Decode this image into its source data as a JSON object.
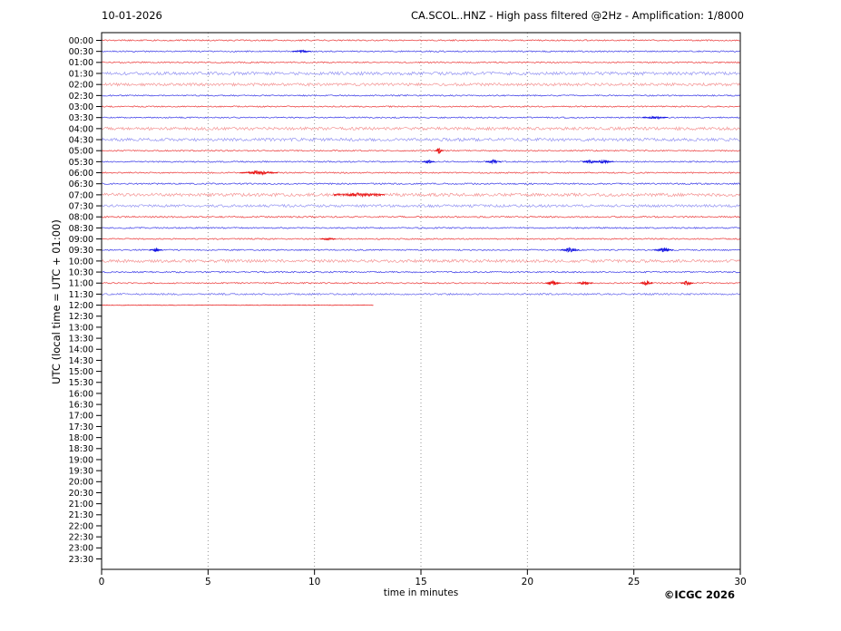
{
  "header": {
    "date": "10-01-2026",
    "title": "CA.SCOL..HNZ - High pass filtered @2Hz - Amplification: 1/8000"
  },
  "footer": {
    "copyright": "©ICGC 2026"
  },
  "chart_data": {
    "type": "line",
    "subtype": "helicorder-seismogram",
    "title": "CA.SCOL..HNZ - High pass filtered @2Hz - Amplification: 1/8000",
    "date_label": "10-01-2026",
    "xlabel": "time in minutes",
    "ylabel": "UTC (local time = UTC + 01:00)",
    "xlim": [
      0,
      30
    ],
    "x_ticks": [
      0,
      5,
      10,
      15,
      20,
      25,
      30
    ],
    "grid_minutes": [
      5,
      10,
      15,
      20,
      25
    ],
    "grid_style": "dotted",
    "legend": "none",
    "colors": {
      "red": "#e60000",
      "blue": "#0000e0",
      "grid": "#8a8a8a",
      "frame": "#000000"
    },
    "trace_color_rule": "hh:00 rows red, hh:30 rows blue; recording stops at 12:00 + 12.8 min",
    "rows": [
      {
        "label": "00:00",
        "color": "red",
        "noise": 0.7,
        "end_minute": 30,
        "events": []
      },
      {
        "label": "00:30",
        "color": "blue",
        "noise": 0.7,
        "end_minute": 30,
        "events": [
          {
            "m": 9.4,
            "a": 0.9,
            "w": 0.15
          }
        ]
      },
      {
        "label": "01:00",
        "color": "red",
        "noise": 0.7,
        "end_minute": 30,
        "events": []
      },
      {
        "label": "01:30",
        "color": "blue",
        "noise": 1.7,
        "end_minute": 30,
        "events": []
      },
      {
        "label": "02:00",
        "color": "red",
        "noise": 1.5,
        "end_minute": 30,
        "events": []
      },
      {
        "label": "02:30",
        "color": "blue",
        "noise": 0.7,
        "end_minute": 30,
        "events": []
      },
      {
        "label": "03:00",
        "color": "red",
        "noise": 0.7,
        "end_minute": 30,
        "events": []
      },
      {
        "label": "03:30",
        "color": "blue",
        "noise": 0.7,
        "end_minute": 30,
        "events": [
          {
            "m": 26.0,
            "a": 0.9,
            "w": 0.2
          }
        ]
      },
      {
        "label": "04:00",
        "color": "red",
        "noise": 1.6,
        "end_minute": 30,
        "events": []
      },
      {
        "label": "04:30",
        "color": "blue",
        "noise": 1.6,
        "end_minute": 30,
        "events": []
      },
      {
        "label": "05:00",
        "color": "red",
        "noise": 0.7,
        "end_minute": 30,
        "events": [
          {
            "m": 15.85,
            "a": 3.3,
            "w": 0.07
          }
        ]
      },
      {
        "label": "05:30",
        "color": "blue",
        "noise": 0.7,
        "end_minute": 30,
        "events": [
          {
            "m": 15.35,
            "a": 1.6,
            "w": 0.1
          },
          {
            "m": 18.4,
            "a": 1.5,
            "w": 0.12
          },
          {
            "m": 22.95,
            "a": 1.5,
            "w": 0.12
          },
          {
            "m": 23.6,
            "a": 1.6,
            "w": 0.15
          }
        ]
      },
      {
        "label": "06:00",
        "color": "red",
        "noise": 0.7,
        "end_minute": 30,
        "events": [
          {
            "m": 7.4,
            "a": 1.8,
            "w": 0.3
          }
        ]
      },
      {
        "label": "06:30",
        "color": "blue",
        "noise": 0.8,
        "end_minute": 30,
        "events": []
      },
      {
        "label": "07:00",
        "color": "red",
        "noise": 1.7,
        "end_minute": 30,
        "events": [
          {
            "m": 12.1,
            "a": 1.2,
            "w": 0.4
          }
        ]
      },
      {
        "label": "07:30",
        "color": "blue",
        "noise": 1.4,
        "end_minute": 30,
        "events": []
      },
      {
        "label": "08:00",
        "color": "red",
        "noise": 0.8,
        "end_minute": 30,
        "events": []
      },
      {
        "label": "08:30",
        "color": "blue",
        "noise": 0.7,
        "end_minute": 30,
        "events": []
      },
      {
        "label": "09:00",
        "color": "red",
        "noise": 0.7,
        "end_minute": 30,
        "events": [
          {
            "m": 10.65,
            "a": 0.9,
            "w": 0.12
          }
        ]
      },
      {
        "label": "09:30",
        "color": "blue",
        "noise": 0.7,
        "end_minute": 30,
        "events": [
          {
            "m": 2.55,
            "a": 1.4,
            "w": 0.1
          },
          {
            "m": 22.0,
            "a": 2.0,
            "w": 0.15
          },
          {
            "m": 26.4,
            "a": 2.0,
            "w": 0.15
          }
        ]
      },
      {
        "label": "10:00",
        "color": "red",
        "noise": 1.6,
        "end_minute": 30,
        "events": []
      },
      {
        "label": "10:30",
        "color": "blue",
        "noise": 0.8,
        "end_minute": 30,
        "events": []
      },
      {
        "label": "11:00",
        "color": "red",
        "noise": 0.7,
        "end_minute": 30,
        "events": [
          {
            "m": 21.2,
            "a": 1.9,
            "w": 0.12
          },
          {
            "m": 22.7,
            "a": 2.2,
            "w": 0.12
          },
          {
            "m": 25.6,
            "a": 1.9,
            "w": 0.1
          },
          {
            "m": 27.5,
            "a": 2.2,
            "w": 0.1
          }
        ]
      },
      {
        "label": "11:30",
        "color": "blue",
        "noise": 0.9,
        "end_minute": 30,
        "events": []
      },
      {
        "label": "12:00",
        "color": "red",
        "noise": 0.3,
        "end_minute": 12.8,
        "events": []
      },
      {
        "label": "12:30",
        "color": null,
        "noise": 0,
        "end_minute": 0,
        "events": []
      },
      {
        "label": "13:00",
        "color": null,
        "noise": 0,
        "end_minute": 0,
        "events": []
      },
      {
        "label": "13:30",
        "color": null,
        "noise": 0,
        "end_minute": 0,
        "events": []
      },
      {
        "label": "14:00",
        "color": null,
        "noise": 0,
        "end_minute": 0,
        "events": []
      },
      {
        "label": "14:30",
        "color": null,
        "noise": 0,
        "end_minute": 0,
        "events": []
      },
      {
        "label": "15:00",
        "color": null,
        "noise": 0,
        "end_minute": 0,
        "events": []
      },
      {
        "label": "15:30",
        "color": null,
        "noise": 0,
        "end_minute": 0,
        "events": []
      },
      {
        "label": "16:00",
        "color": null,
        "noise": 0,
        "end_minute": 0,
        "events": []
      },
      {
        "label": "16:30",
        "color": null,
        "noise": 0,
        "end_minute": 0,
        "events": []
      },
      {
        "label": "17:00",
        "color": null,
        "noise": 0,
        "end_minute": 0,
        "events": []
      },
      {
        "label": "17:30",
        "color": null,
        "noise": 0,
        "end_minute": 0,
        "events": []
      },
      {
        "label": "18:00",
        "color": null,
        "noise": 0,
        "end_minute": 0,
        "events": []
      },
      {
        "label": "18:30",
        "color": null,
        "noise": 0,
        "end_minute": 0,
        "events": []
      },
      {
        "label": "19:00",
        "color": null,
        "noise": 0,
        "end_minute": 0,
        "events": []
      },
      {
        "label": "19:30",
        "color": null,
        "noise": 0,
        "end_minute": 0,
        "events": []
      },
      {
        "label": "20:00",
        "color": null,
        "noise": 0,
        "end_minute": 0,
        "events": []
      },
      {
        "label": "20:30",
        "color": null,
        "noise": 0,
        "end_minute": 0,
        "events": []
      },
      {
        "label": "21:00",
        "color": null,
        "noise": 0,
        "end_minute": 0,
        "events": []
      },
      {
        "label": "21:30",
        "color": null,
        "noise": 0,
        "end_minute": 0,
        "events": []
      },
      {
        "label": "22:00",
        "color": null,
        "noise": 0,
        "end_minute": 0,
        "events": []
      },
      {
        "label": "22:30",
        "color": null,
        "noise": 0,
        "end_minute": 0,
        "events": []
      },
      {
        "label": "23:00",
        "color": null,
        "noise": 0,
        "end_minute": 0,
        "events": []
      },
      {
        "label": "23:30",
        "color": null,
        "noise": 0,
        "end_minute": 0,
        "events": []
      }
    ]
  }
}
